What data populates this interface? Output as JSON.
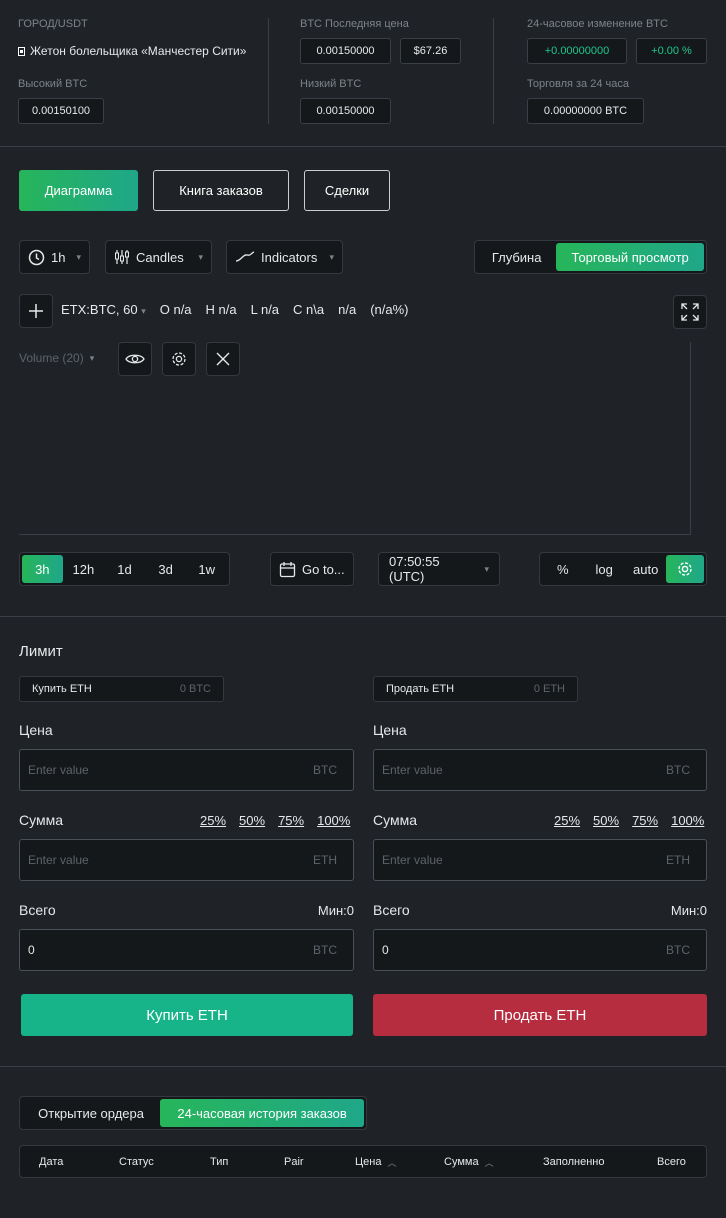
{
  "ticker": {
    "pair_label": "ГОРОД/USDT",
    "token_name": "Жетон болельщика «Манчестер Сити»",
    "last_price_label": "BTC Последняя цена",
    "last_price": "0.00150000",
    "last_price_usd": "$67.26",
    "change_label": "24-часовое изменение BTC",
    "change_value": "+0.00000000",
    "change_pct": "+0.00 %",
    "high_label": "Высокий BTC",
    "high_value": "0.00150100",
    "low_label": "Низкий BTC",
    "low_value": "0.00150000",
    "volume_label": "Торговля за 24 часа",
    "volume_value": "0.00000000 BTC"
  },
  "tabs": {
    "chart": "Диаграмма",
    "orderbook": "Книга заказов",
    "trades": "Сделки"
  },
  "toolbar": {
    "interval": "1h",
    "candles": "Candles",
    "indicators": "Indicators",
    "depth": "Глубина",
    "trading_view": "Торговый просмотр"
  },
  "legend": {
    "symbol": "ETX:BTC, 60",
    "open": "O n/a",
    "high": "H n/a",
    "low": "L n/a",
    "close": "C n\\a",
    "change": "n/a",
    "change_pct": "(n/a%)",
    "volume": "Volume (20)"
  },
  "bottom_bar": {
    "ranges": [
      "3h",
      "12h",
      "1d",
      "3d",
      "1w"
    ],
    "goto": "Go to...",
    "time": "07:50:55 (UTC)",
    "percent": "%",
    "log": "log",
    "auto": "auto"
  },
  "order_form": {
    "title": "Лимит",
    "buy": {
      "pill_label": "Купить ETH",
      "pill_value": "0 BTC",
      "price_label": "Цена",
      "price_placeholder": "Enter value",
      "price_unit": "BTC",
      "amount_label": "Сумма",
      "amount_placeholder": "Enter value",
      "amount_unit": "ETH",
      "total_label": "Всего",
      "min": "Мин:0",
      "total_value": "0",
      "total_unit": "BTC",
      "button": "Купить ETH"
    },
    "sell": {
      "pill_label": "Продать ETH",
      "pill_value": "0 ETH",
      "price_label": "Цена",
      "price_placeholder": "Enter value",
      "price_unit": "BTC",
      "amount_label": "Сумма",
      "amount_placeholder": "Enter value",
      "amount_unit": "ETH",
      "total_label": "Всего",
      "min": "Мин:0",
      "total_value": "0",
      "total_unit": "BTC",
      "button": "Продать ETH"
    },
    "percents": [
      "25%",
      "50%",
      "75%",
      "100%"
    ]
  },
  "orders": {
    "tab_open": "Открытие ордера",
    "tab_history": "24-часовая история заказов",
    "columns": [
      "Дата",
      "Статус",
      "Тип",
      "Pair",
      "Цена",
      "Сумма",
      "Заполненно",
      "Всего"
    ]
  },
  "colors": {
    "accent": "#1fc78a",
    "buy": "#17b48a",
    "sell": "#b52d3f",
    "background": "#1f2327"
  }
}
